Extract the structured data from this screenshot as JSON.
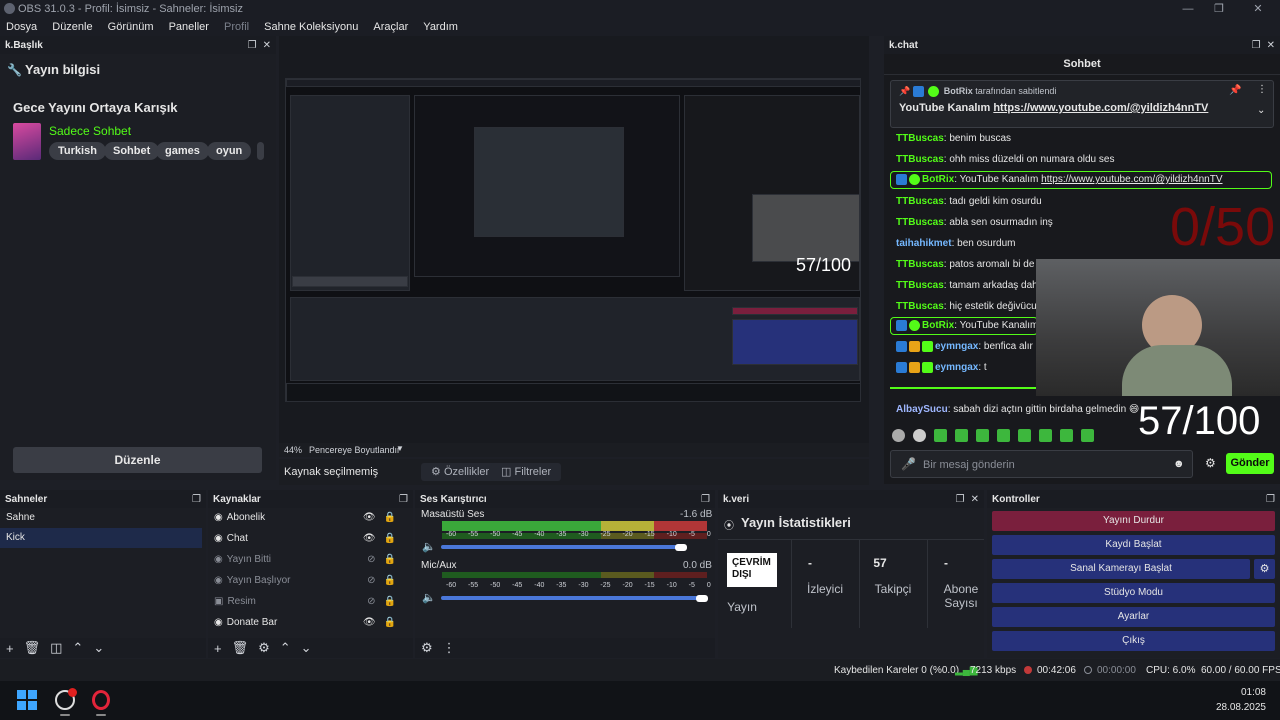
{
  "window": {
    "title": "OBS 31.0.3 - Profil: İsimsiz - Sahneler: İsimsiz"
  },
  "menu": [
    "Dosya",
    "Düzenle",
    "Görünüm",
    "Paneller",
    "Profil",
    "Sahne Koleksiyonu",
    "Araçlar",
    "Yardım"
  ],
  "title_dock": {
    "header": "k.Başlık",
    "heading": "Yayın bilgisi",
    "stream_title": "Gece Yayını Ortaya Karışık",
    "category": "Sadece Sohbet",
    "tags": [
      "Turkish",
      "Sohbet",
      "games",
      "oyun"
    ],
    "edit_label": "Düzenle"
  },
  "preview": {
    "zoom": "44%",
    "zoom_mode": "Pencereye Boyutlandır"
  },
  "source_bar": {
    "no_source": "Kaynak seçilmemiş",
    "properties": "Özellikler",
    "filters": "Filtreler"
  },
  "chat_dock": {
    "header": "k.chat",
    "tab": "Sohbet",
    "pinned_by": "BotRix",
    "pinned_suffix": "tarafından sabitlendi",
    "pinned_text": "YouTube Kanalım",
    "pinned_link": "https://www.youtube.com/@yildizh4nnTV",
    "messages": [
      {
        "user": "TTBuscas",
        "text": "benim buscas"
      },
      {
        "user": "TTBuscas",
        "text": "ohh miss düzeldi on numara oldu ses"
      },
      {
        "user": "BotRix",
        "text": "YouTube Kanalım",
        "link": "https://www.youtube.com/@yildizh4nnTV"
      },
      {
        "user": "TTBuscas",
        "text": "tadı geldi kim osurdu"
      },
      {
        "user": "TTBuscas",
        "text": "abla sen osurmadın inş"
      },
      {
        "user": "taihahikmet",
        "text": "ben osurdum"
      },
      {
        "user": "TTBuscas",
        "text": "patos aromalı bi de en"
      },
      {
        "user": "TTBuscas",
        "text": "tamam arkadaş daha k"
      },
      {
        "user": "TTBuscas",
        "text": "hiç estetik değivücudu"
      },
      {
        "user": "BotRix",
        "text": "YouTube Kanalım",
        "link": "h"
      },
      {
        "user": "eymngax",
        "text": "benfica alır a"
      },
      {
        "user": "eymngax",
        "text": "t"
      },
      {
        "user": "AlbaySucu",
        "text": "sabah dizi açtın gittin birdaha gelmedin 😄"
      }
    ],
    "overlay_goal_faded": "0/50",
    "overlay_goal": "57/100",
    "input_placeholder": "Bir mesaj gönderin",
    "send_label": "Gönder"
  },
  "scenes": {
    "header": "Sahneler",
    "items": [
      "Sahne",
      "Kick"
    ],
    "selected": "Kick"
  },
  "sources": {
    "header": "Kaynaklar",
    "items": [
      {
        "name": "Abonelik",
        "visible": true
      },
      {
        "name": "Chat",
        "visible": true
      },
      {
        "name": "Yayın Bitti",
        "visible": false
      },
      {
        "name": "Yayın Başlıyor",
        "visible": false
      },
      {
        "name": "Resim",
        "visible": false
      },
      {
        "name": "Donate Bar",
        "visible": true
      }
    ]
  },
  "mixer": {
    "header": "Ses Karıştırıcı",
    "scale": "-60 -55 -50 -45 -40 -35 -30 -25 -20 -15 -10 -5 0",
    "channels": [
      {
        "name": "Masaüstü Ses",
        "db": "-1.6 dB",
        "volume": 0.98
      },
      {
        "name": "Mic/Aux",
        "db": "0.0 dB",
        "volume": 1.0
      }
    ]
  },
  "stats": {
    "header": "k.veri",
    "title": "Yayın İstatistikleri",
    "status": "ÇEVRİM DIŞI",
    "status_label": "Yayın",
    "viewers_value": "-",
    "viewers_label": "İzleyici",
    "followers_value": "57",
    "followers_label": "Takipçi",
    "subs_value": "-",
    "subs_label": "Abone Sayısı"
  },
  "controls": {
    "header": "Kontroller",
    "stop_stream": "Yayını Durdur",
    "start_record": "Kaydı Başlat",
    "virtual_cam": "Sanal Kamerayı Başlat",
    "studio_mode": "Stüdyo Modu",
    "settings": "Ayarlar",
    "exit": "Çıkış"
  },
  "status_bar": {
    "dropped": "Kaybedilen Kareler 0 (%0.0)",
    "bitrate": "7213 kbps",
    "stream_time": "00:42:06",
    "record_time": "00:00:00",
    "cpu": "CPU: 6.0%",
    "fps": "60.00 / 60.00 FPS"
  },
  "taskbar": {
    "time": "01:08",
    "date": "28.08.2025"
  },
  "colors": {
    "kick_green": "#53fc18",
    "stop_red": "#7a1f3d",
    "control_blue": "#26317a",
    "selected_scene": "#1e2a4a"
  }
}
